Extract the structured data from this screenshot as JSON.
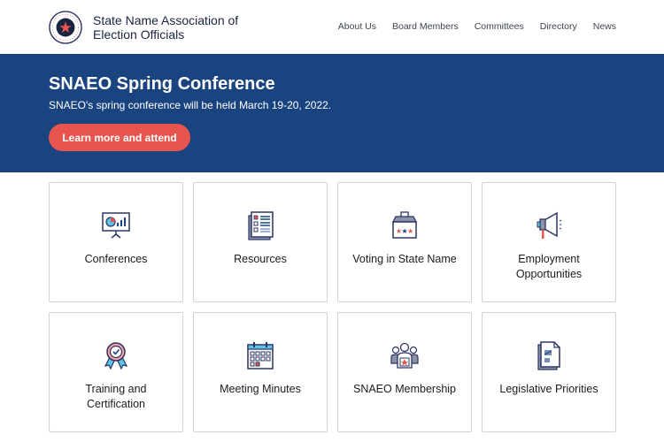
{
  "header": {
    "logo_alt": "State Name Association seal",
    "site_title": "State Name Association of Election Officials",
    "nav": [
      "About Us",
      "Board Members",
      "Committees",
      "Directory",
      "News"
    ]
  },
  "hero": {
    "title": "SNAEO Spring Conference",
    "text": "SNAEO's spring conference will be held March 19-20, 2022.",
    "button_label": "Learn more and attend"
  },
  "cards": [
    {
      "label": "Conferences",
      "icon": "presentation-icon"
    },
    {
      "label": "Resources",
      "icon": "document-list-icon"
    },
    {
      "label": "Voting in State Name",
      "icon": "ballot-box-icon"
    },
    {
      "label": "Employment Opportunities",
      "icon": "megaphone-icon"
    },
    {
      "label": "Training and Certification",
      "icon": "award-ribbon-icon"
    },
    {
      "label": "Meeting Minutes",
      "icon": "calendar-icon"
    },
    {
      "label": "SNAEO Membership",
      "icon": "people-group-icon"
    },
    {
      "label": "Legislative Priorities",
      "icon": "legislation-document-icon"
    }
  ],
  "colors": {
    "primary": "#1a4480",
    "accent": "#e8554e",
    "icon_dark": "#2b3563",
    "icon_light_blue": "#5fc2e8"
  }
}
